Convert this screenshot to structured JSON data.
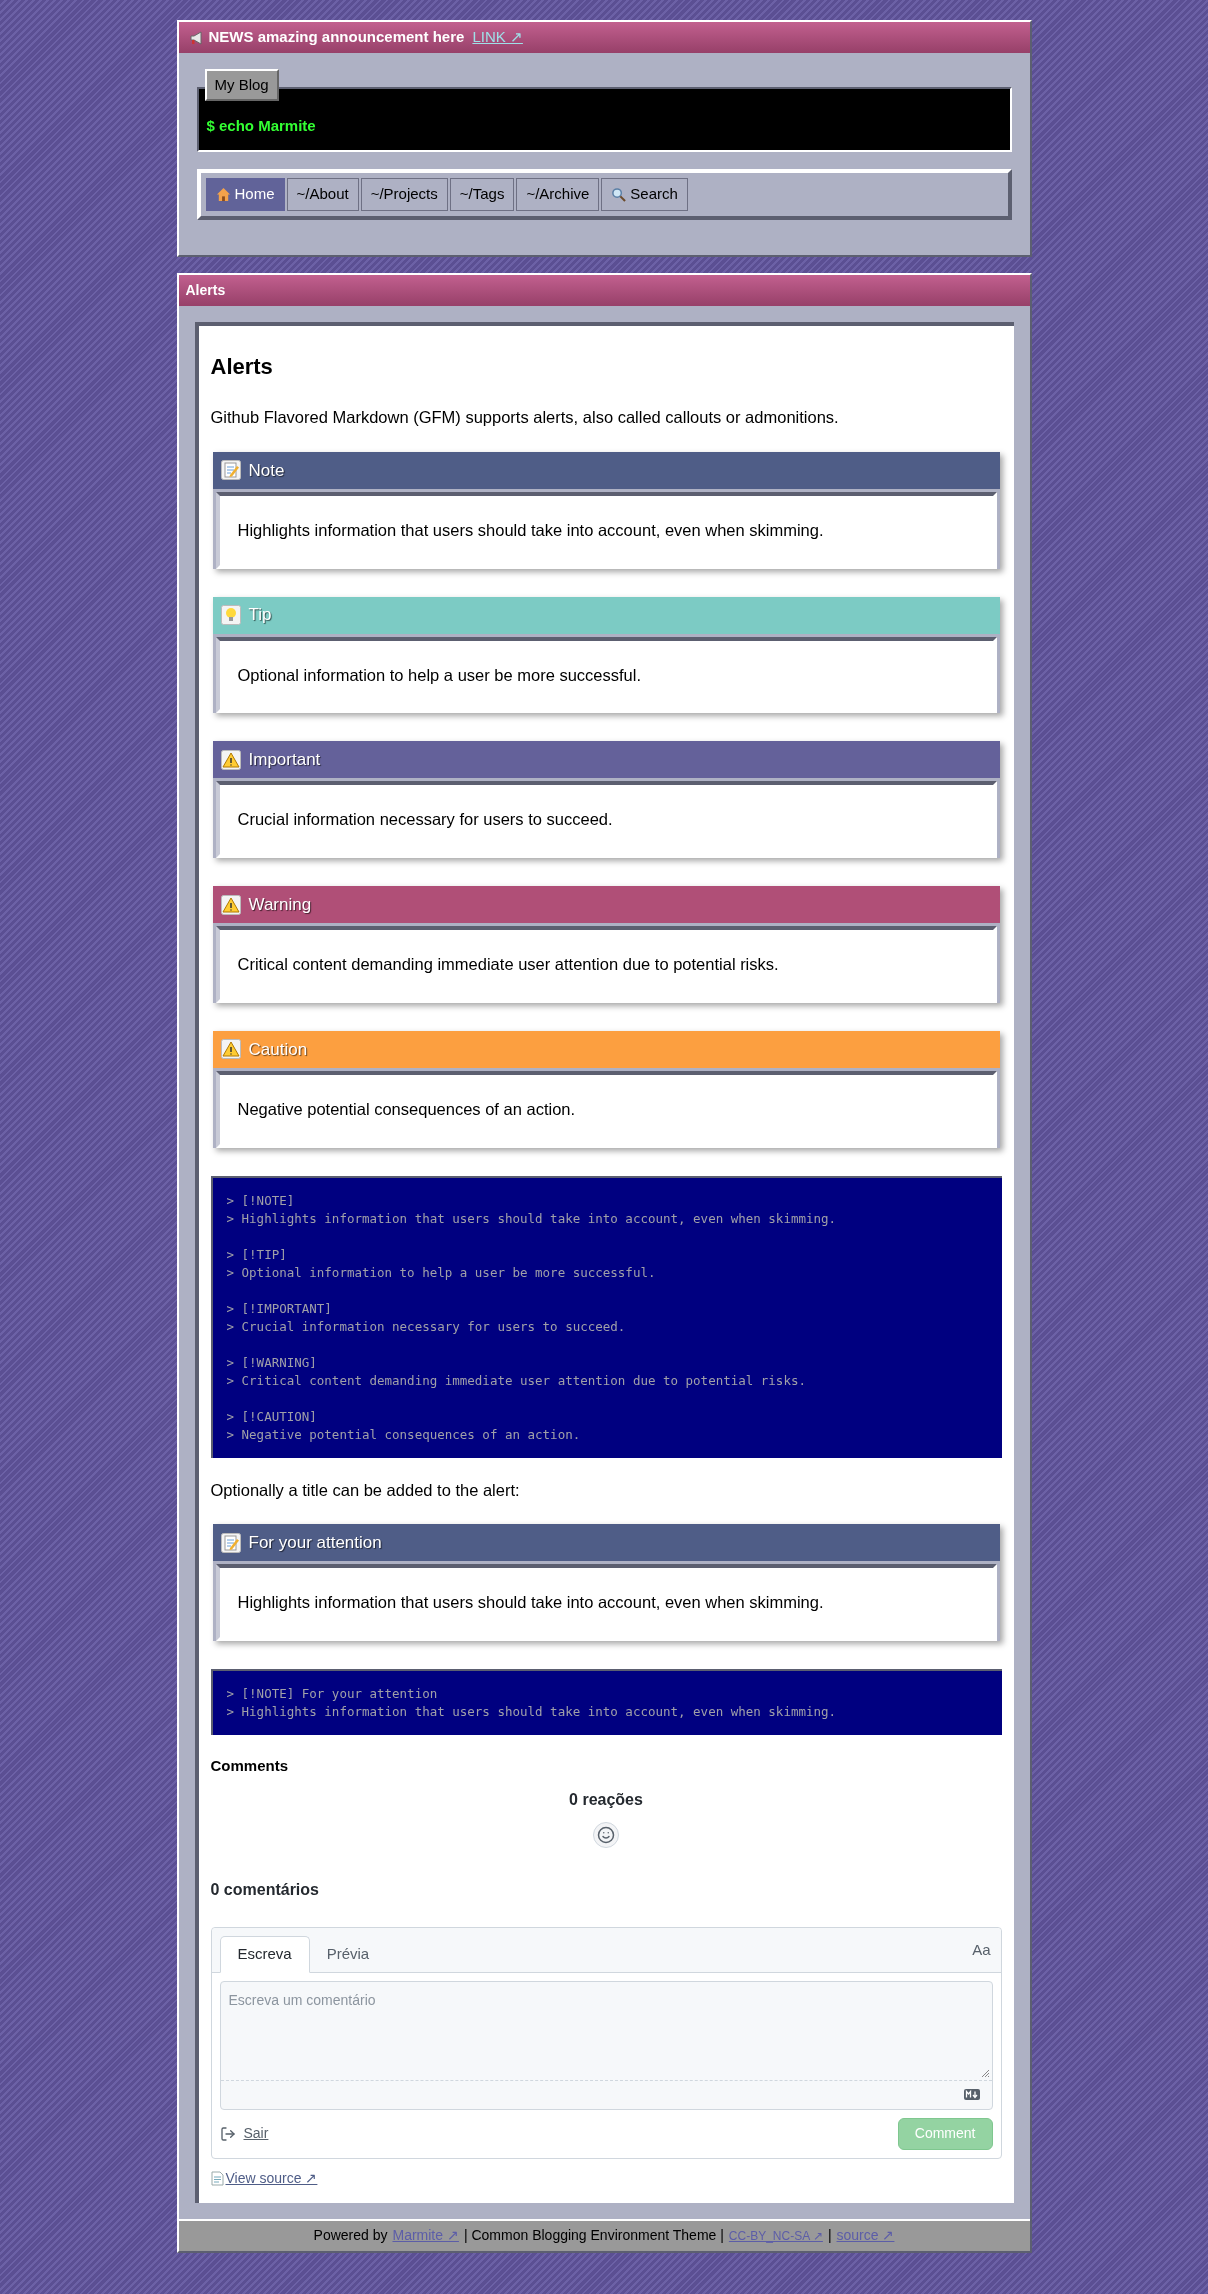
{
  "news": {
    "text": "NEWS amazing announcement here",
    "link": "LINK ↗"
  },
  "blog": {
    "tab": "My Blog",
    "prompt": "$ echo Marmite"
  },
  "nav": [
    {
      "label": "Home",
      "kind": "home",
      "selected": true
    },
    {
      "label": "~/About",
      "kind": "link",
      "selected": false
    },
    {
      "label": "~/Projects",
      "kind": "link",
      "selected": false
    },
    {
      "label": "~/Tags",
      "kind": "link",
      "selected": false
    },
    {
      "label": "~/Archive",
      "kind": "link",
      "selected": false
    },
    {
      "label": "Search",
      "kind": "search",
      "selected": false
    }
  ],
  "panel_title": "Alerts",
  "content": [
    {
      "kind": "heading",
      "text": "Alerts"
    },
    {
      "kind": "paragraph",
      "text": "Github Flavored Markdown (GFM) supports alerts, also called callouts or admonitions."
    },
    {
      "kind": "note",
      "color": "#4f5d87",
      "title": "Note",
      "text": "Highlights information that users should take into account, even when skimming."
    },
    {
      "kind": "tip",
      "color": "#7ccbc4",
      "title": "Tip",
      "text": "Optional information to help a user be more successful."
    },
    {
      "kind": "important",
      "color": "#64619a",
      "title": "Important",
      "text": "Crucial information necessary for users to succeed."
    },
    {
      "kind": "warning",
      "color": "#b04f77",
      "title": "Warning",
      "text": "Critical content demanding immediate user attention due to potential risks."
    },
    {
      "kind": "caution",
      "color": "#fc9f40",
      "title": "Caution",
      "text": "Negative potential consequences of an action."
    },
    {
      "kind": "code",
      "groups": [
        [
          "> [!NOTE]",
          "> Highlights information that users should take into account, even when skimming."
        ],
        [
          "> [!TIP]",
          "> Optional information to help a user be more successful."
        ],
        [
          "> [!IMPORTANT]",
          "> Crucial information necessary for users to succeed."
        ],
        [
          "> [!WARNING]",
          "> Critical content demanding immediate user attention due to potential risks."
        ],
        [
          "> [!CAUTION]",
          "> Negative potential consequences of an action."
        ]
      ]
    },
    {
      "kind": "paragraph",
      "text": "Optionally a title can be added to the alert:"
    },
    {
      "kind": "note",
      "color": "#4f5d87",
      "title": "For your attention",
      "text": "Highlights information that users should take into account, even when skimming."
    },
    {
      "kind": "code",
      "groups": [
        [
          "> [!NOTE] For your attention",
          "> Highlights information that users should take into account, even when skimming."
        ]
      ]
    }
  ],
  "comments": {
    "heading": "Comments",
    "reactions": "0 reações",
    "count": "0 comentários",
    "tabs": [
      {
        "label": "Escreva",
        "selected": true
      },
      {
        "label": "Prévia",
        "selected": false
      }
    ],
    "font_toggle": "Aa",
    "placeholder": "Escreva um comentário",
    "sign_out": "Sair",
    "submit": {
      "label": "Comment",
      "disabled": true
    }
  },
  "view_source": "View source ↗",
  "footer": [
    {
      "kind": "text",
      "text": "Powered by"
    },
    {
      "kind": "link",
      "text": "Marmite ↗"
    },
    {
      "kind": "text",
      "text": "| Common Blogging Environment Theme |"
    },
    {
      "kind": "small-link",
      "text": "CC-BY_NC-SA ↗"
    },
    {
      "kind": "text",
      "text": "|"
    },
    {
      "kind": "link",
      "text": "source ↗"
    }
  ]
}
